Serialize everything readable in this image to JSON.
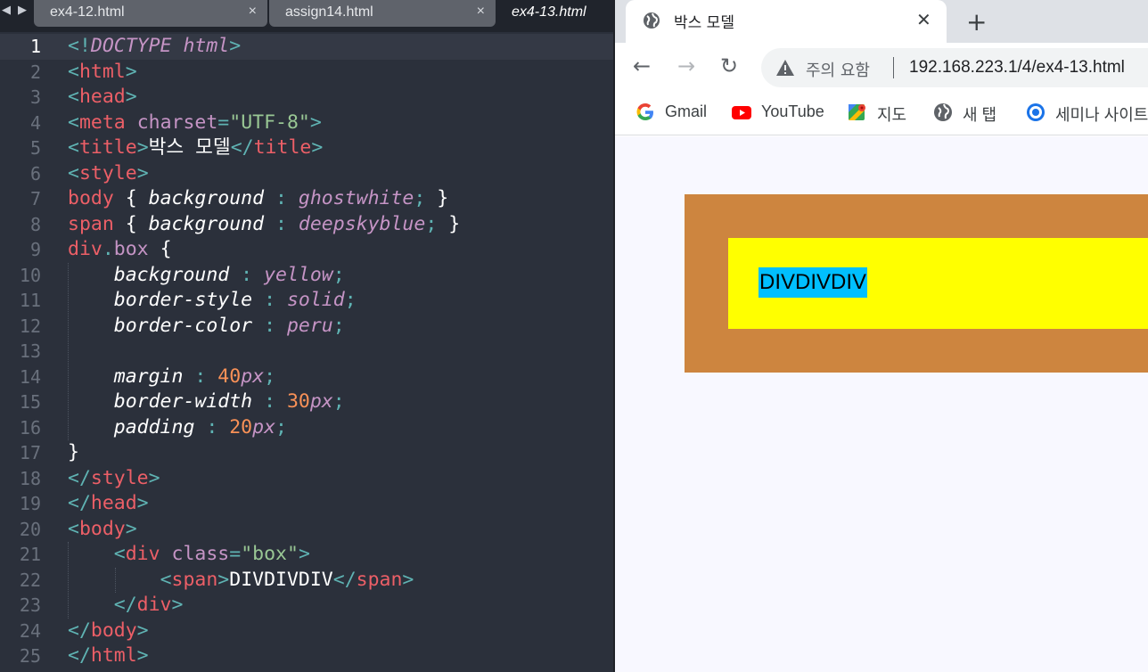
{
  "editor": {
    "tabs": [
      {
        "label": "ex4-12.html",
        "close": "×"
      },
      {
        "label": "assign14.html",
        "close": "×"
      },
      {
        "label": "ex4-13.html"
      }
    ],
    "lines": [
      {
        "num": "1",
        "tokens": [
          [
            "p",
            "<!"
          ],
          [
            "doc",
            "DOCTYPE"
          ],
          [
            "t",
            " "
          ],
          [
            "doc",
            "html"
          ],
          [
            "p",
            ">"
          ]
        ]
      },
      {
        "num": "2",
        "tokens": [
          [
            "p",
            "<"
          ],
          [
            "tag",
            "html"
          ],
          [
            "p",
            ">"
          ]
        ]
      },
      {
        "num": "3",
        "tokens": [
          [
            "p",
            "<"
          ],
          [
            "tag",
            "head"
          ],
          [
            "p",
            ">"
          ]
        ]
      },
      {
        "num": "4",
        "tokens": [
          [
            "p",
            "<"
          ],
          [
            "tag",
            "meta"
          ],
          [
            "t",
            " "
          ],
          [
            "attr",
            "charset"
          ],
          [
            "p",
            "="
          ],
          [
            "str",
            "\"UTF-8\""
          ],
          [
            "p",
            ">"
          ]
        ]
      },
      {
        "num": "5",
        "tokens": [
          [
            "p",
            "<"
          ],
          [
            "tag",
            "title"
          ],
          [
            "p",
            ">"
          ],
          [
            "txt",
            "박스 모델"
          ],
          [
            "p",
            "</"
          ],
          [
            "tag",
            "title"
          ],
          [
            "p",
            ">"
          ]
        ]
      },
      {
        "num": "6",
        "tokens": [
          [
            "p",
            "<"
          ],
          [
            "tag",
            "style"
          ],
          [
            "p",
            ">"
          ]
        ]
      },
      {
        "num": "7",
        "tokens": [
          [
            "sel",
            "body"
          ],
          [
            "txt",
            " { "
          ],
          [
            "prop",
            "background"
          ],
          [
            "p",
            " : "
          ],
          [
            "val",
            "ghostwhite"
          ],
          [
            "p",
            ";"
          ],
          [
            "txt",
            " }"
          ]
        ]
      },
      {
        "num": "8",
        "tokens": [
          [
            "sel",
            "span"
          ],
          [
            "txt",
            " { "
          ],
          [
            "prop",
            "background"
          ],
          [
            "p",
            " : "
          ],
          [
            "val",
            "deepskyblue"
          ],
          [
            "p",
            ";"
          ],
          [
            "txt",
            " }"
          ]
        ]
      },
      {
        "num": "9",
        "tokens": [
          [
            "sel",
            "div"
          ],
          [
            "p",
            "."
          ],
          [
            "cls",
            "box"
          ],
          [
            "txt",
            " {"
          ]
        ]
      },
      {
        "num": "10",
        "tokens": [
          [
            "t",
            "    "
          ],
          [
            "prop",
            "background"
          ],
          [
            "p",
            " : "
          ],
          [
            "val",
            "yellow"
          ],
          [
            "p",
            ";"
          ]
        ]
      },
      {
        "num": "11",
        "tokens": [
          [
            "t",
            "    "
          ],
          [
            "prop",
            "border-style"
          ],
          [
            "p",
            " : "
          ],
          [
            "val",
            "solid"
          ],
          [
            "p",
            ";"
          ]
        ]
      },
      {
        "num": "12",
        "tokens": [
          [
            "t",
            "    "
          ],
          [
            "prop",
            "border-color"
          ],
          [
            "p",
            " : "
          ],
          [
            "val",
            "peru"
          ],
          [
            "p",
            ";"
          ]
        ]
      },
      {
        "num": "13",
        "tokens": []
      },
      {
        "num": "14",
        "tokens": [
          [
            "t",
            "    "
          ],
          [
            "prop",
            "margin"
          ],
          [
            "p",
            " : "
          ],
          [
            "num",
            "40"
          ],
          [
            "unit",
            "px"
          ],
          [
            "p",
            ";"
          ]
        ]
      },
      {
        "num": "15",
        "tokens": [
          [
            "t",
            "    "
          ],
          [
            "prop",
            "border-width"
          ],
          [
            "p",
            " : "
          ],
          [
            "num",
            "30"
          ],
          [
            "unit",
            "px"
          ],
          [
            "p",
            ";"
          ]
        ]
      },
      {
        "num": "16",
        "tokens": [
          [
            "t",
            "    "
          ],
          [
            "prop",
            "padding"
          ],
          [
            "p",
            " : "
          ],
          [
            "num",
            "20"
          ],
          [
            "unit",
            "px"
          ],
          [
            "p",
            ";"
          ]
        ]
      },
      {
        "num": "17",
        "tokens": [
          [
            "txt",
            "}"
          ]
        ]
      },
      {
        "num": "18",
        "tokens": [
          [
            "p",
            "</"
          ],
          [
            "tag",
            "style"
          ],
          [
            "p",
            ">"
          ]
        ]
      },
      {
        "num": "19",
        "tokens": [
          [
            "p",
            "</"
          ],
          [
            "tag",
            "head"
          ],
          [
            "p",
            ">"
          ]
        ]
      },
      {
        "num": "20",
        "tokens": [
          [
            "p",
            "<"
          ],
          [
            "tag",
            "body"
          ],
          [
            "p",
            ">"
          ]
        ]
      },
      {
        "num": "21",
        "tokens": [
          [
            "t",
            "    "
          ],
          [
            "p",
            "<"
          ],
          [
            "tag",
            "div"
          ],
          [
            "t",
            " "
          ],
          [
            "attr",
            "class"
          ],
          [
            "p",
            "="
          ],
          [
            "str",
            "\"box\""
          ],
          [
            "p",
            ">"
          ]
        ]
      },
      {
        "num": "22",
        "tokens": [
          [
            "t",
            "        "
          ],
          [
            "p",
            "<"
          ],
          [
            "tag",
            "span"
          ],
          [
            "p",
            ">"
          ],
          [
            "txt",
            "DIVDIVDIV"
          ],
          [
            "p",
            "</"
          ],
          [
            "tag",
            "span"
          ],
          [
            "p",
            ">"
          ]
        ]
      },
      {
        "num": "23",
        "tokens": [
          [
            "t",
            "    "
          ],
          [
            "p",
            "</"
          ],
          [
            "tag",
            "div"
          ],
          [
            "p",
            ">"
          ]
        ]
      },
      {
        "num": "24",
        "tokens": [
          [
            "p",
            "</"
          ],
          [
            "tag",
            "body"
          ],
          [
            "p",
            ">"
          ]
        ]
      },
      {
        "num": "25",
        "tokens": [
          [
            "p",
            "</"
          ],
          [
            "tag",
            "html"
          ],
          [
            "p",
            ">"
          ]
        ]
      }
    ]
  },
  "browser": {
    "tab_title": "박스 모델",
    "tab_close": "✕",
    "new_tab": "+",
    "back": "←",
    "forward": "→",
    "reload": "↻",
    "security_text": "주의 요함",
    "url": "192.168.223.1/4/ex4-13.html",
    "bookmarks": [
      {
        "label": "Gmail",
        "icon": "google-icon"
      },
      {
        "label": "YouTube",
        "icon": "youtube-icon"
      },
      {
        "label": "지도",
        "icon": "maps-icon"
      },
      {
        "label": "새 탭",
        "icon": "globe-icon"
      },
      {
        "label": "세미나 사이트",
        "icon": "seminar-icon"
      }
    ],
    "page": {
      "span_text": "DIVDIVDIV",
      "body_bg": "#f8f8ff",
      "box_bg": "#ffff00",
      "box_border": "#cd853f",
      "span_bg": "#00bfff"
    }
  }
}
